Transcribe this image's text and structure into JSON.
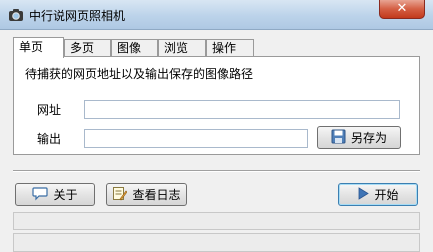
{
  "window": {
    "title": "中行说网页照相机",
    "close_glyph": "✕"
  },
  "tabs": [
    {
      "label": "单页",
      "active": true
    },
    {
      "label": "多页",
      "active": false
    },
    {
      "label": "图像",
      "active": false
    },
    {
      "label": "浏览",
      "active": false
    },
    {
      "label": "操作",
      "active": false
    }
  ],
  "panel": {
    "description": "待捕获的网页地址以及输出保存的图像路径",
    "url_label": "网址",
    "url_value": "",
    "output_label": "输出",
    "output_value": "",
    "save_as_label": "另存为"
  },
  "buttons": {
    "about_label": "关于",
    "view_log_label": "查看日志",
    "start_label": "开始"
  },
  "icons": {
    "app": "camera-icon",
    "save": "floppy-disk-icon",
    "about": "speech-bubble-icon",
    "log": "notepad-pencil-icon",
    "start": "play-icon"
  },
  "colors": {
    "title_bar": "#bcd3ea",
    "close_button": "#c9432a",
    "default_button_border": "#3c7fb1"
  }
}
